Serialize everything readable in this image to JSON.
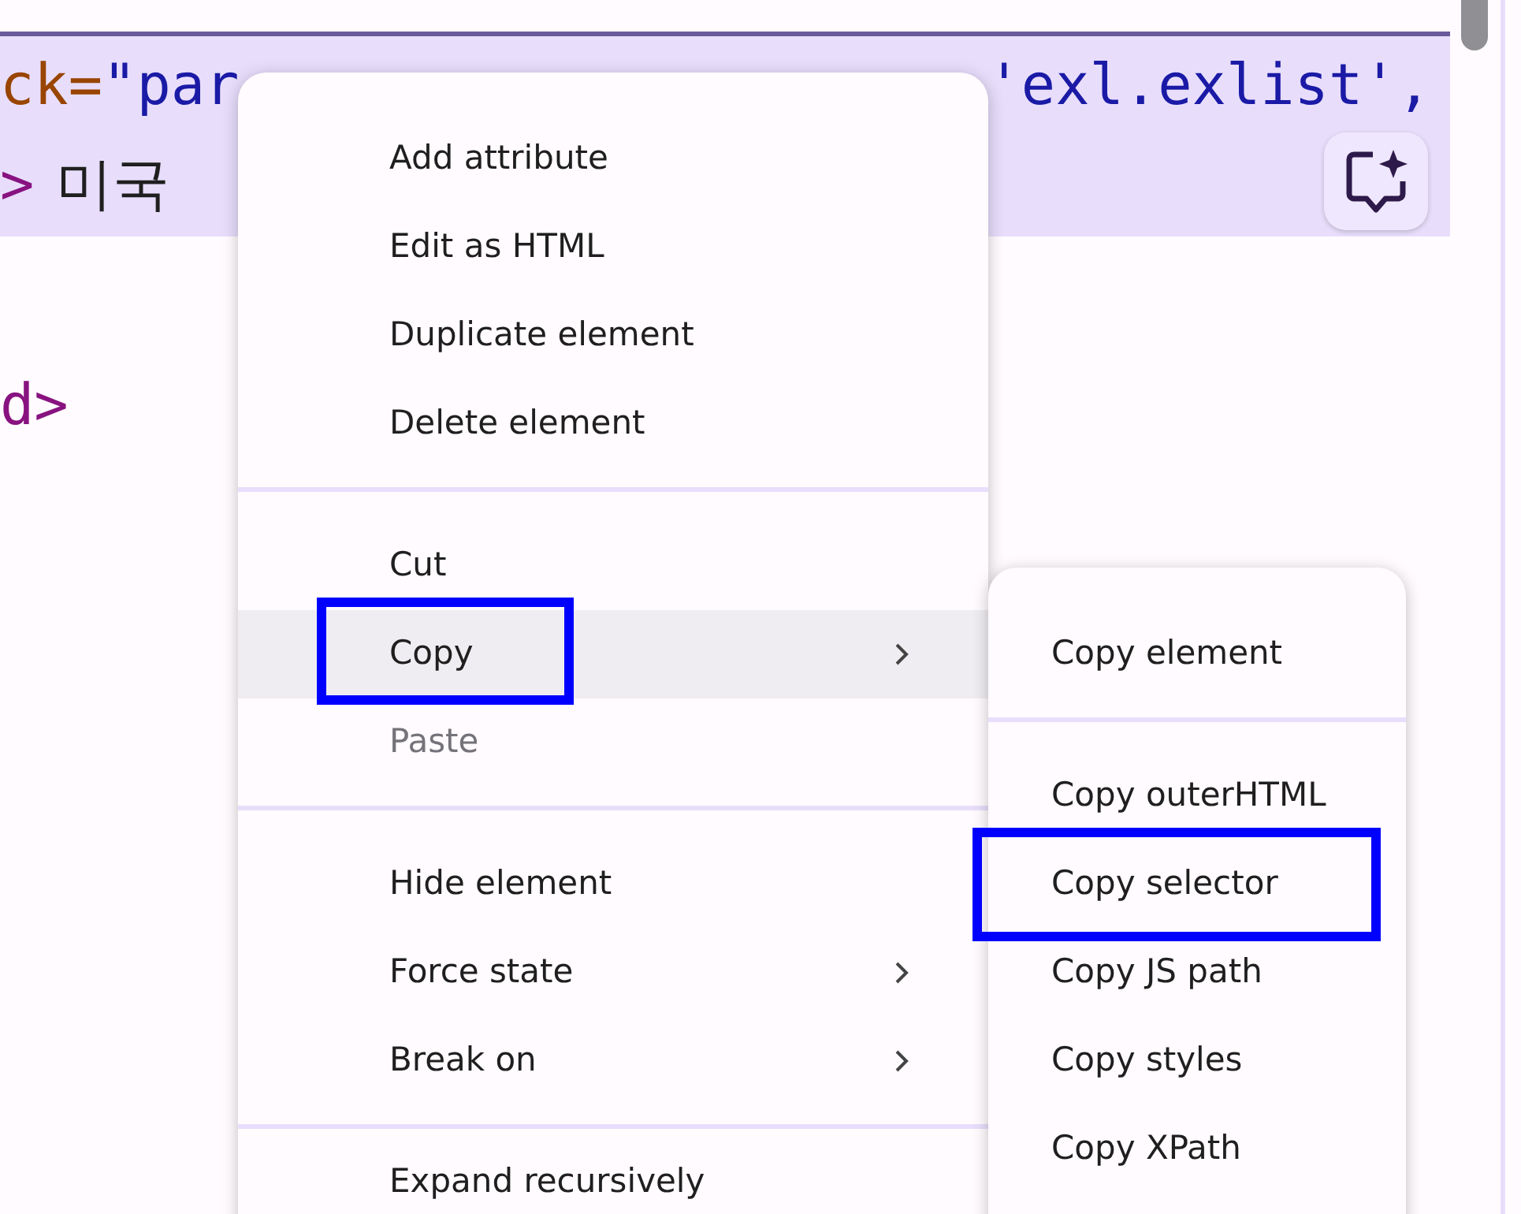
{
  "code_lines": [
    {
      "highlighted": true,
      "left": [
        {
          "kind": "attr",
          "text": "ck="
        },
        {
          "kind": "string",
          "text": "\"par"
        }
      ],
      "right": [
        {
          "kind": "string",
          "text": "'exl.exlist',"
        }
      ]
    },
    {
      "highlighted": true,
      "left": [
        {
          "kind": "tag",
          "text": ">"
        },
        {
          "kind": "text",
          "text": "미국"
        }
      ]
    },
    {
      "highlighted": false,
      "left": [
        {
          "kind": "tag",
          "text": "d>"
        }
      ]
    }
  ],
  "context_menu": {
    "groups": [
      [
        {
          "label": "Add attribute",
          "selected": false,
          "disabled": false,
          "has_submenu": false,
          "annotated": false
        },
        {
          "label": "Edit as HTML",
          "selected": false,
          "disabled": false,
          "has_submenu": false,
          "annotated": false
        },
        {
          "label": "Duplicate element",
          "selected": false,
          "disabled": false,
          "has_submenu": false,
          "annotated": false
        },
        {
          "label": "Delete element",
          "selected": false,
          "disabled": false,
          "has_submenu": false,
          "annotated": false
        }
      ],
      [
        {
          "label": "Cut",
          "selected": false,
          "disabled": false,
          "has_submenu": false,
          "annotated": false
        },
        {
          "label": "Copy",
          "selected": true,
          "disabled": false,
          "has_submenu": true,
          "annotated": true
        },
        {
          "label": "Paste",
          "selected": false,
          "disabled": true,
          "has_submenu": false,
          "annotated": false
        }
      ],
      [
        {
          "label": "Hide element",
          "selected": false,
          "disabled": false,
          "has_submenu": false,
          "annotated": false
        },
        {
          "label": "Force state",
          "selected": false,
          "disabled": false,
          "has_submenu": true,
          "annotated": false
        },
        {
          "label": "Break on",
          "selected": false,
          "disabled": false,
          "has_submenu": true,
          "annotated": false
        }
      ],
      [
        {
          "label": "Expand recursively",
          "selected": false,
          "disabled": false,
          "has_submenu": false,
          "annotated": false
        }
      ]
    ]
  },
  "submenu": {
    "groups": [
      [
        {
          "label": "Copy element",
          "selected": false,
          "disabled": false,
          "has_submenu": false,
          "annotated": false
        }
      ],
      [
        {
          "label": "Copy outerHTML",
          "selected": false,
          "disabled": false,
          "has_submenu": false,
          "annotated": false
        },
        {
          "label": "Copy selector",
          "selected": false,
          "disabled": false,
          "has_submenu": false,
          "annotated": true
        },
        {
          "label": "Copy JS path",
          "selected": false,
          "disabled": false,
          "has_submenu": false,
          "annotated": false
        },
        {
          "label": "Copy styles",
          "selected": false,
          "disabled": false,
          "has_submenu": false,
          "annotated": false
        },
        {
          "label": "Copy XPath",
          "selected": false,
          "disabled": false,
          "has_submenu": false,
          "annotated": false
        }
      ]
    ]
  }
}
